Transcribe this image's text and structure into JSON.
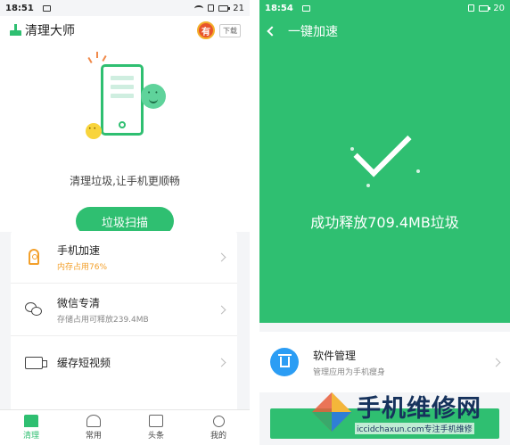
{
  "left": {
    "status": {
      "time": "18:51",
      "battery": "21"
    },
    "header": {
      "title": "清理大师",
      "badge": "有",
      "download": "下载"
    },
    "hero": {
      "caption": "清理垃圾,让手机更顺畅",
      "scan_button": "垃圾扫描"
    },
    "features": [
      {
        "title": "手机加速",
        "subtitle": "内存占用76%",
        "icon": "rocket-icon"
      },
      {
        "title": "微信专清",
        "subtitle": "存储占用可释放239.4MB",
        "icon": "wechat-icon"
      },
      {
        "title": "缓存短视频",
        "subtitle": "",
        "icon": "video-icon"
      }
    ],
    "tabs": [
      {
        "label": "清理",
        "icon": "broom-icon",
        "active": true
      },
      {
        "label": "常用",
        "icon": "apps-icon",
        "active": false
      },
      {
        "label": "头条",
        "icon": "news-icon",
        "active": false
      },
      {
        "label": "我的",
        "icon": "person-icon",
        "active": false
      }
    ]
  },
  "right": {
    "status": {
      "time": "18:54",
      "battery": "20"
    },
    "header": {
      "title": "一键加速"
    },
    "result": {
      "text": "成功释放709.4MB垃圾"
    },
    "card": {
      "title": "软件管理",
      "subtitle": "管理应用为手机瘦身"
    }
  },
  "watermark": {
    "title": "手机维修网",
    "url": "iccidchaxun.com专注手机维修"
  },
  "colors": {
    "accent": "#2fbf71",
    "warning": "#f3a02b",
    "blue": "#2b9df4"
  }
}
